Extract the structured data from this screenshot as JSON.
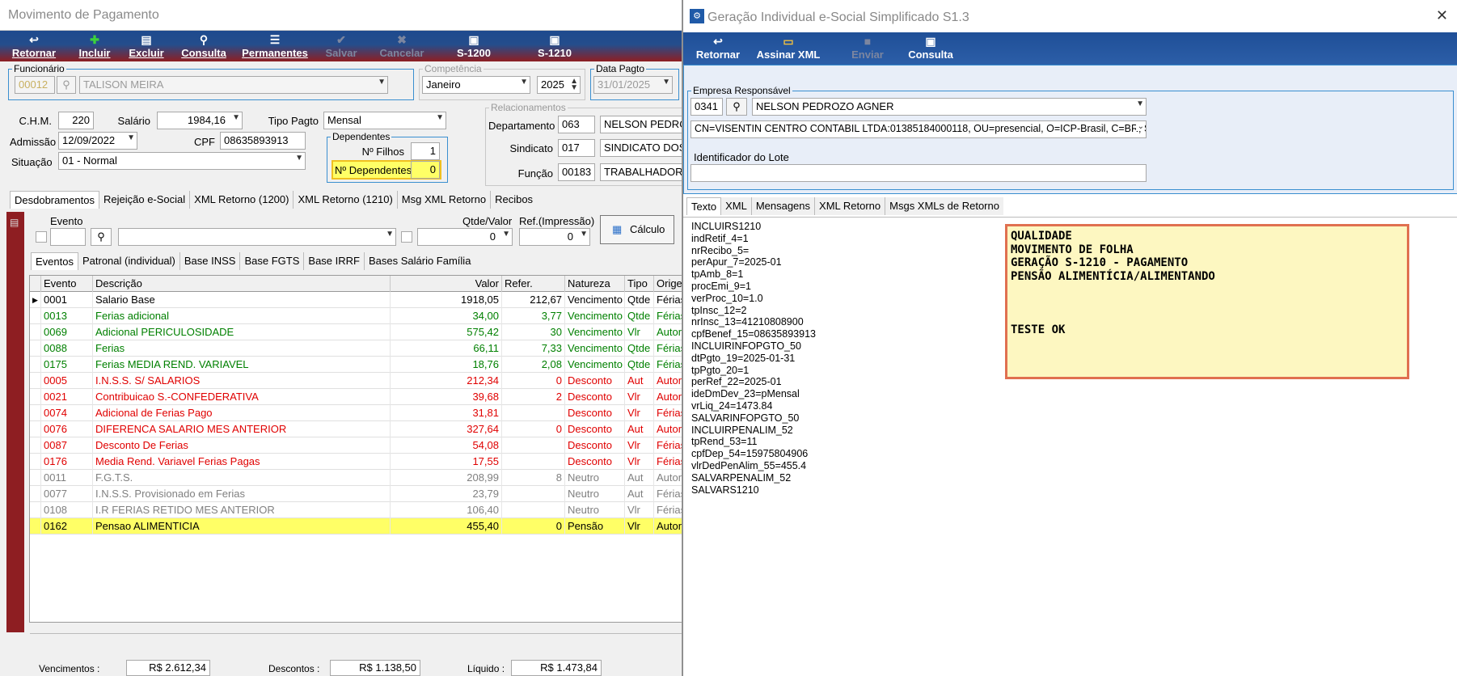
{
  "left": {
    "title": "Movimento de Pagamento",
    "toolbar": [
      {
        "label": "Retornar",
        "icon": "↩",
        "disabled": false
      },
      {
        "label": "Incluir",
        "icon": "✚",
        "disabled": false
      },
      {
        "label": "Excluir",
        "icon": "▤",
        "disabled": false
      },
      {
        "label": "Consulta",
        "icon": "⚲",
        "disabled": false
      },
      {
        "label": "Permanentes",
        "icon": "☰",
        "disabled": false
      },
      {
        "label": "Salvar",
        "icon": "✔",
        "disabled": true
      },
      {
        "label": "Cancelar",
        "icon": "✖",
        "disabled": true
      },
      {
        "label": "S-1200",
        "icon": "▣",
        "disabled": false
      },
      {
        "label": "S-1210",
        "icon": "▣",
        "disabled": false
      }
    ],
    "funcionario": {
      "legend": "Funcionário",
      "code": "00012",
      "name": "TALISON MEIRA"
    },
    "competencia": {
      "legend": "Competência",
      "month": "Janeiro",
      "year": "2025"
    },
    "data_pagto": {
      "legend": "Data Pagto",
      "value": "31/01/2025"
    },
    "chm": {
      "label": "C.H.M.",
      "value": "220"
    },
    "salario": {
      "label": "Salário",
      "value": "1984,16"
    },
    "tipo_pagto": {
      "label": "Tipo Pagto",
      "value": "Mensal"
    },
    "admissao": {
      "label": "Admissão",
      "value": "12/09/2022"
    },
    "cpf": {
      "label": "CPF",
      "value": "08635893913"
    },
    "situacao": {
      "label": "Situação",
      "value": "01 - Normal"
    },
    "dependentes": {
      "legend": "Dependentes",
      "filhos_label": "Nº Filhos",
      "filhos": "1",
      "dep_label": "Nº Dependentes",
      "dep": "0"
    },
    "relacionamentos": {
      "legend": "Relacionamentos",
      "departamento": {
        "label": "Departamento",
        "code": "063",
        "name": "NELSON PEDRO"
      },
      "sindicato": {
        "label": "Sindicato",
        "code": "017",
        "name": "SINDICATO DOS"
      },
      "funcao": {
        "label": "Função",
        "code": "00183",
        "name": "TRABALHADOR"
      }
    },
    "tabs": [
      "Desdobramentos",
      "Rejeição e-Social",
      "XML Retorno (1200)",
      "XML Retorno (1210)",
      "Msg XML Retorno",
      "Recibos"
    ],
    "evento_label": "Evento",
    "qtde_label": "Qtde/Valor",
    "qtde_value": "0",
    "ref_label": "Ref.(Impressão)",
    "ref_value": "0",
    "calculo_label": "Cálculo",
    "subtabs": [
      "Eventos",
      "Patronal (individual)",
      "Base INSS",
      "Base FGTS",
      "Base IRRF",
      "Bases Salário Família"
    ],
    "grid_headers": [
      "Evento",
      "Descrição",
      "Valor",
      "Refer.",
      "Natureza",
      "Tipo",
      "Origem"
    ],
    "rows": [
      [
        "0001",
        "Salario Base",
        "1918,05",
        "212,67",
        "Vencimento",
        "Qtde",
        "Férias",
        "#000000"
      ],
      [
        "0013",
        "Ferias adicional",
        "34,00",
        "3,77",
        "Vencimento",
        "Qtde",
        "Férias",
        "#008000"
      ],
      [
        "0069",
        "Adicional PERICULOSIDADE",
        "575,42",
        "30",
        "Vencimento",
        "Vlr",
        "Automático",
        "#008000"
      ],
      [
        "0088",
        "Ferias",
        "66,11",
        "7,33",
        "Vencimento",
        "Qtde",
        "Férias",
        "#008000"
      ],
      [
        "0175",
        "Ferias MEDIA REND. VARIAVEL",
        "18,76",
        "2,08",
        "Vencimento",
        "Qtde",
        "Férias",
        "#008000"
      ],
      [
        "0005",
        "I.N.S.S. S/ SALARIOS",
        "212,34",
        "0",
        "Desconto",
        "Aut",
        "Automático",
        "#e00000"
      ],
      [
        "0021",
        "Contribuicao S.-CONFEDERATIVA",
        "39,68",
        "2",
        "Desconto",
        "Vlr",
        "Automático",
        "#e00000"
      ],
      [
        "0074",
        "Adicional de Ferias Pago",
        "31,81",
        "",
        "Desconto",
        "Vlr",
        "Férias",
        "#e00000"
      ],
      [
        "0076",
        "DIFERENCA SALARIO MES ANTERIOR",
        "327,64",
        "0",
        "Desconto",
        "Aut",
        "Automático",
        "#e00000"
      ],
      [
        "0087",
        "Desconto De Ferias",
        "54,08",
        "",
        "Desconto",
        "Vlr",
        "Férias",
        "#e00000"
      ],
      [
        "0176",
        "Media  Rend. Variavel Ferias Pagas",
        "17,55",
        "",
        "Desconto",
        "Vlr",
        "Férias",
        "#e00000"
      ],
      [
        "0011",
        "F.G.T.S.",
        "208,99",
        "8",
        "Neutro",
        "Aut",
        "Automático",
        "#808080"
      ],
      [
        "0077",
        "I.N.S.S. Provisionado em Ferias",
        "23,79",
        "",
        "Neutro",
        "Aut",
        "Férias",
        "#808080"
      ],
      [
        "0108",
        "I.R FERIAS RETIDO MES ANTERIOR",
        "106,40",
        "",
        "Neutro",
        "Vlr",
        "Férias",
        "#808080"
      ],
      [
        "0162",
        "Pensao ALIMENTICIA",
        "455,40",
        "0",
        "Pensão",
        "Vlr",
        "Automático",
        "#000000"
      ]
    ],
    "totals": {
      "venc_label": "Vencimentos :",
      "venc": "R$ 2.612,34",
      "desc_label": "Descontos :",
      "desc": "R$ 1.138,50",
      "liq_label": "Líquido :",
      "liq": "R$ 1.473,84"
    }
  },
  "right": {
    "title": "Geração Individual e-Social Simplificado S1.3",
    "toolbar": [
      {
        "label": "Retornar",
        "icon": "↩",
        "disabled": false
      },
      {
        "label": "Assinar XML",
        "icon": "▭",
        "disabled": false
      },
      {
        "label": "Enviar",
        "icon": "■",
        "disabled": true
      },
      {
        "label": "Consulta",
        "icon": "▣",
        "disabled": false
      }
    ],
    "empresa": {
      "legend": "Empresa Responsável",
      "code": "0341",
      "name": "NELSON PEDROZO AGNER"
    },
    "certificado": "CN=VISENTIN CENTRO CONTABIL LTDA:01385184000118, OU=presencial, O=ICP-Brasil, C=BR, S",
    "lote_label": "Identificador do Lote",
    "lote_value": "",
    "tabs": [
      "Texto",
      "XML",
      "Mensagens",
      "XML Retorno",
      "Msgs XMLs de Retorno"
    ],
    "texto": "INCLUIRS1210\nindRetif_4=1\nnrRecibo_5=\nperApur_7=2025-01\ntpAmb_8=1\nprocEmi_9=1\nverProc_10=1.0\ntpInsc_12=2\nnrInsc_13=41210808900\ncpfBenef_15=08635893913\nINCLUIRINFOPGTO_50\ndtPgto_19=2025-01-31\ntpPgto_20=1\nperRef_22=2025-01\nideDmDev_23=pMensal\nvrLiq_24=1473.84\nSALVARINFOPGTO_50\nINCLUIRPENALIM_52\ntpRend_53=11\ncpfDep_54=15975804906\nvlrDedPenAlim_55=455.4\nSALVARPENALIM_52\nSALVARS1210",
    "note": "QUALIDADE\nMOVIMENTO DE FOLHA\nGERAÇÃO S-1210 - PAGAMENTO\nPENSÃO ALIMENTÍCIA/ALIMENTANDO\n\n\n\nTESTE OK"
  }
}
